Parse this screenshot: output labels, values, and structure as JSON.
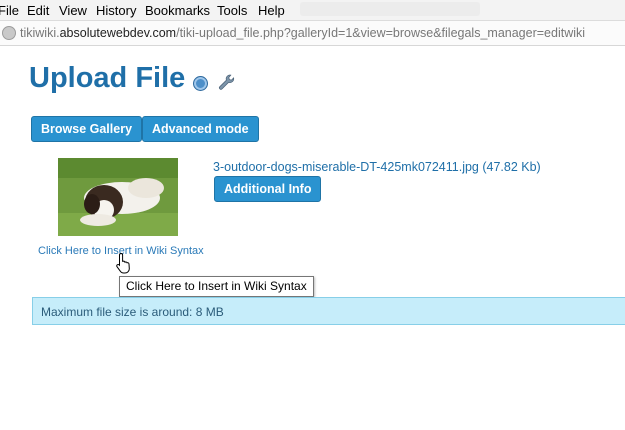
{
  "menu": [
    "File",
    "Edit",
    "View",
    "History",
    "Bookmarks",
    "Tools",
    "Help"
  ],
  "address": {
    "host_prefix": "tikiwiki.",
    "host_domain": "absolutewebdev.com",
    "path": "/tiki-upload_file.php?galleryId=1&view=browse&filegals_manager=editwiki"
  },
  "page": {
    "title": "Upload File",
    "buttons": {
      "browse": "Browse Gallery",
      "advanced": "Advanced mode",
      "additional_info": "Additional Info"
    },
    "file": {
      "name_and_size": "3-outdoor-dogs-miserable-DT-425mk072411.jpg (47.82 Kb)",
      "insert_link": "Click Here to Insert in Wiki Syntax"
    },
    "tooltip": "Click Here to Insert in Wiki Syntax",
    "alert": "Maximum file size is around: 8 MB"
  },
  "icons": [
    "globe-icon",
    "help-icon",
    "wrench-icon",
    "hand-cursor-icon"
  ],
  "colors": {
    "title": "#1f6fa8",
    "button": "#2a93d0",
    "alert_bg": "#c6edfa"
  }
}
